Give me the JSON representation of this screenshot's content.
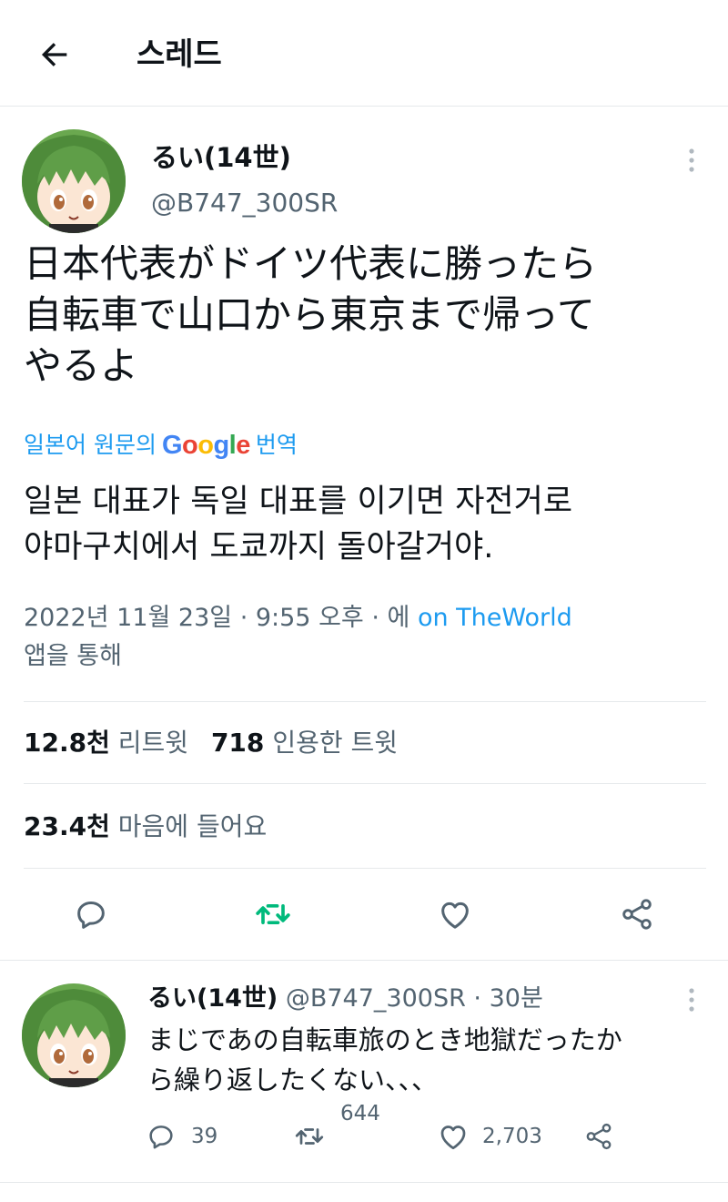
{
  "header": {
    "title": "스레드"
  },
  "tweet": {
    "name": "るい(14世)",
    "handle": "@B747_300SR",
    "text_lines": [
      "日本代表がドイツ代表に勝ったら",
      "自転車で山口から東京まで帰って",
      "やるよ"
    ],
    "translate_prefix": "일본어 원문의",
    "translate_suffix": "번역",
    "google_letters": [
      "G",
      "o",
      "o",
      "g",
      "l",
      "e"
    ],
    "translation_lines": [
      "일본 대표가 독일 대표를 이기면 자전거로",
      "야마구치에서 도쿄까지 돌아갈거야."
    ],
    "meta_line1": "2022년 11월 23일 · 9:55 오후 · 에",
    "meta_app": "on TheWorld",
    "meta_line2": "앱을 통해",
    "retweets_count": "12.8천",
    "retweets_label": "리트윗",
    "quotes_count": "718",
    "quotes_label": "인용한 트윗",
    "likes_count": "23.4천",
    "likes_label": "마음에 들어요"
  },
  "reply": {
    "name": "るい(14世)",
    "handle_time": "@B747_300SR · 30분",
    "text_lines": [
      "まじであの自転車旅のとき地獄だったか",
      "ら繰り返したくない、、、"
    ],
    "replies": "39",
    "retweets": "644",
    "likes": "2,703"
  },
  "colors": {
    "accent": "#1d9bf0",
    "retweet_green": "#00ba7c",
    "muted": "#536471",
    "google": [
      "#4285F4",
      "#EA4335",
      "#FBBC05",
      "#4285F4",
      "#34A853",
      "#EA4335"
    ]
  }
}
